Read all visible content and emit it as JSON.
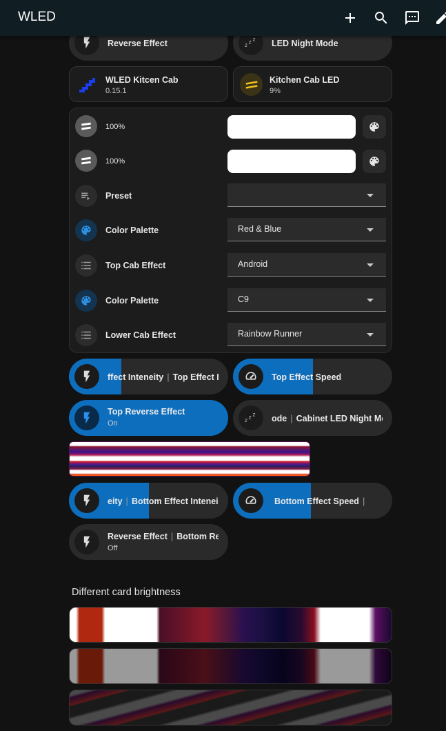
{
  "app": {
    "title": "WLED"
  },
  "colors": {
    "accent": "#0d6ebd",
    "topbar": "#101e24",
    "background": "#121212"
  },
  "toolbar": {
    "icons": [
      "plus-icon",
      "search-icon",
      "chat-icon",
      "pencil-icon"
    ]
  },
  "top_pills": [
    {
      "name": "Reverse Effect",
      "icon": "lightning-icon"
    },
    {
      "name": "LED Night Mode",
      "icon": "sleep-icon"
    }
  ],
  "tiles": [
    {
      "name": "WLED Kitcen Cab",
      "sub": "0.15.1",
      "icon": "wled-logo-icon"
    },
    {
      "name": "Kitchen Cab LED",
      "sub": "9%",
      "icon": "led-strip-icon"
    }
  ],
  "controls": {
    "brightness_rows": [
      {
        "value": "100%",
        "icon": "led-strip-icon",
        "color": "#ffffff"
      },
      {
        "value": "100%",
        "icon": "led-strip-icon",
        "color": "#ffffff"
      }
    ],
    "selects": [
      {
        "label": "Preset",
        "value": "",
        "icon": "playlist-icon"
      },
      {
        "label": "Color Palette",
        "value": "Red & Blue",
        "icon": "palette-icon"
      },
      {
        "label": "Top Cab Effect",
        "value": "Android",
        "icon": "list-icon"
      },
      {
        "label": "Color Palette",
        "value": "C9",
        "icon": "palette-icon"
      },
      {
        "label": "Lower Cab Effect",
        "value": "Rainbow Runner",
        "icon": "list-icon"
      }
    ]
  },
  "pills": {
    "top_intensity": {
      "name": "ffect Inteneity",
      "extra": "Top Effect In",
      "icon": "lightning-icon",
      "level_pct": 33
    },
    "top_speed": {
      "name": "Top Effect Speed",
      "icon": "speedometer-icon",
      "level_pct": 50
    },
    "top_reverse": {
      "name": "Top Reverse Effect",
      "state": "On",
      "icon": "lightning-icon"
    },
    "night_mode": {
      "name": "ode",
      "extra": "Cabinet LED Night Mo",
      "icon": "sleep-icon"
    },
    "bottom_intensity": {
      "name": "eity",
      "extra": "Bottom Effect Intenei",
      "icon": "lightning-icon",
      "level_pct": 50
    },
    "bottom_speed": {
      "name": "Bottom Effect Speed",
      "icon": "speedometer-icon",
      "level_pct": 49
    },
    "bottom_reverse": {
      "name": "Reverse Effect",
      "extra": "Bottom Re",
      "state": "Off",
      "icon": "lightning-icon"
    }
  },
  "section": {
    "title": "Different card brightness"
  }
}
